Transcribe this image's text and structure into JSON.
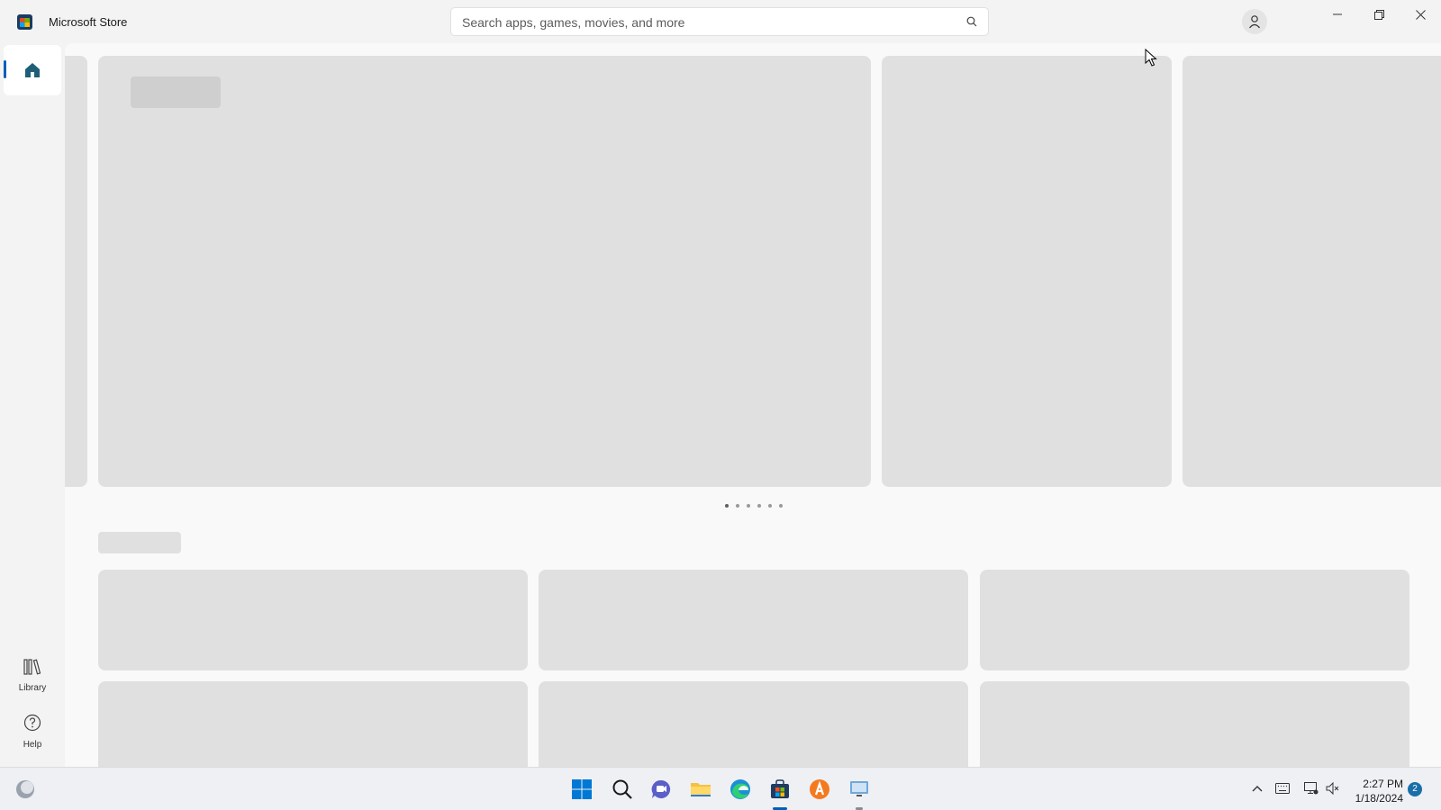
{
  "app": {
    "title": "Microsoft Store"
  },
  "search": {
    "placeholder": "Search apps, games, movies, and more"
  },
  "sidebar": {
    "items": [
      {
        "label": "Library"
      },
      {
        "label": "Help"
      }
    ]
  },
  "carousel": {
    "page_count": 6,
    "active_index": 0
  },
  "taskbar": {
    "apps": [
      "start-icon",
      "search-icon",
      "teams-chat-icon",
      "file-explorer-icon",
      "edge-icon",
      "microsoft-store-icon",
      "avast-icon",
      "remote-desktop-icon"
    ],
    "clock": {
      "time": "2:27 PM",
      "date": "1/18/2024"
    },
    "notification_count": "2"
  },
  "colors": {
    "accent": "#005fb8",
    "placeholder": "#e0e0e0"
  }
}
